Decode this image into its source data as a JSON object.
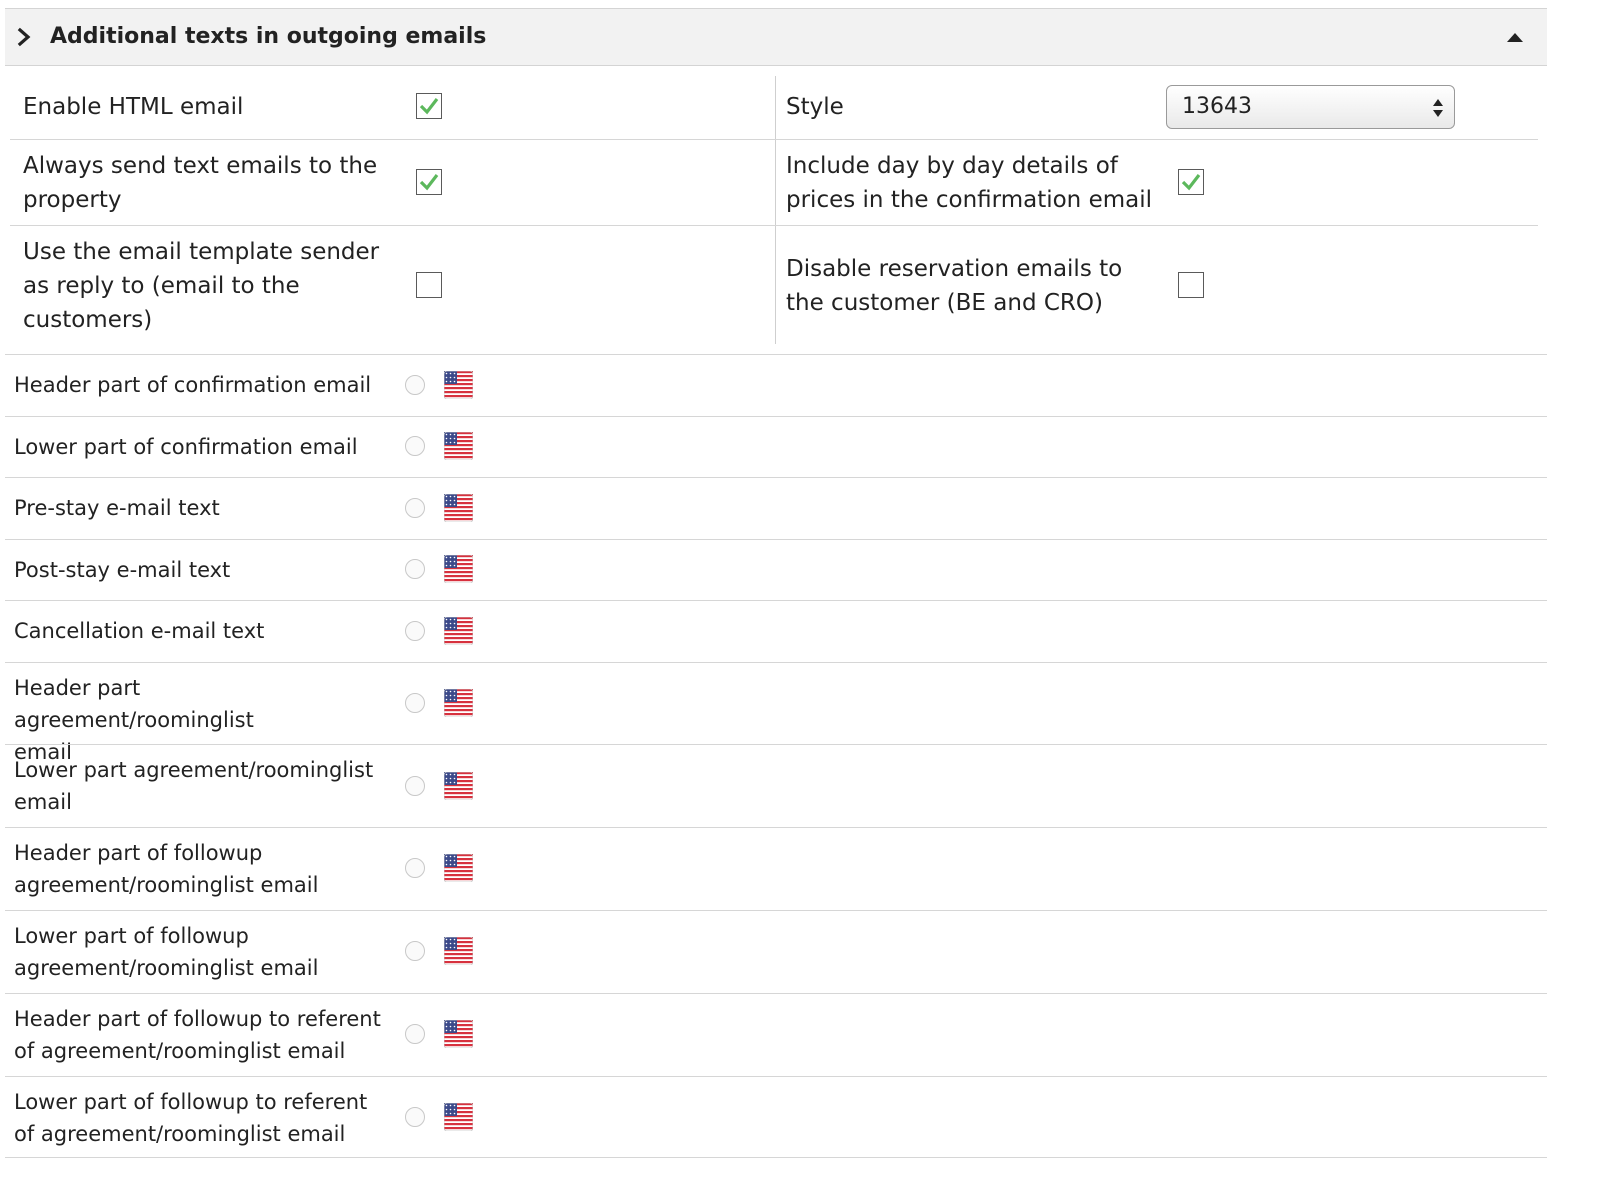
{
  "panel": {
    "title": "Additional texts in outgoing emails"
  },
  "settings": {
    "enable_html_email": {
      "label": "Enable HTML email",
      "checked": true
    },
    "always_send_text": {
      "label_line1": "Always send text emails to the",
      "label_line2": "property",
      "checked": true
    },
    "use_template_sender": {
      "label_line1": "Use the email template sender",
      "label_line2": "as reply to (email to the",
      "label_line3": "customers)",
      "checked": false
    },
    "style": {
      "label": "Style",
      "value": "13643"
    },
    "include_day_by_day": {
      "label_line1": "Include day by day details of",
      "label_line2": "prices in the confirmation email",
      "checked": true
    },
    "disable_reservation_emails": {
      "label_line1": "Disable reservation emails to",
      "label_line2": "the customer (BE and CRO)",
      "checked": false
    }
  },
  "text_rows": [
    {
      "line1": "Header part of confirmation email",
      "line2": ""
    },
    {
      "line1": "Lower part of confirmation email",
      "line2": ""
    },
    {
      "line1": "Pre-stay e-mail text",
      "line2": ""
    },
    {
      "line1": "Post-stay e-mail text",
      "line2": ""
    },
    {
      "line1": "Cancellation e-mail text",
      "line2": ""
    },
    {
      "line1": "Header part agreement/roominglist",
      "line2": "email"
    },
    {
      "line1": "Lower part agreement/roominglist",
      "line2": "email"
    },
    {
      "line1": "Header part of followup",
      "line2": "agreement/roominglist email"
    },
    {
      "line1": "Lower part of followup",
      "line2": "agreement/roominglist email"
    },
    {
      "line1": "Header part of followup to referent",
      "line2": "of agreement/roominglist email"
    },
    {
      "line1": "Lower part of followup to referent",
      "line2": "of agreement/roominglist email"
    }
  ],
  "colors": {
    "check_green": "#5cb85c",
    "header_bg": "#f2f2f2"
  },
  "icons": {
    "expand": "chevron-right-icon",
    "collapse": "caret-up-icon",
    "language": "us-flag-icon"
  }
}
